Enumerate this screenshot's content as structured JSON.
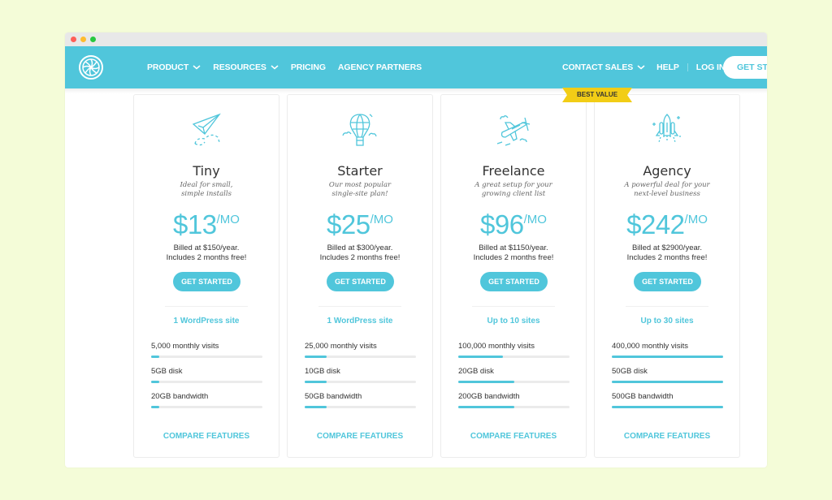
{
  "window": {
    "controls": [
      {
        "name": "close",
        "color": "#fe5f57"
      },
      {
        "name": "minimize",
        "color": "#febc2e"
      },
      {
        "name": "maximize",
        "color": "#28c840"
      }
    ]
  },
  "colors": {
    "brand": "#50c6db",
    "background": "#f4fcd8",
    "badge": "#f2cd16",
    "text": "#333333"
  },
  "navbar": {
    "logo_icon": "aperture-logo-icon",
    "left_items": [
      {
        "label": "PRODUCT",
        "has_dropdown": true
      },
      {
        "label": "RESOURCES",
        "has_dropdown": true
      },
      {
        "label": "PRICING",
        "has_dropdown": false
      },
      {
        "label": "AGENCY PARTNERS",
        "has_dropdown": false
      }
    ],
    "right_items": [
      {
        "label": "CONTACT SALES",
        "has_dropdown": true
      },
      {
        "label": "HELP",
        "has_dropdown": false
      },
      {
        "label": "LOG IN",
        "has_dropdown": false
      }
    ],
    "cta_label": "GET STARTED",
    "cta_visible_text": "GET STA"
  },
  "plans": [
    {
      "name": "Tiny",
      "icon": "paper-plane-icon",
      "desc_line1": "Ideal for small,",
      "desc_line2": "simple installs",
      "price": "$13",
      "per": "/MO",
      "billed": "Billed at $150/year.",
      "free": "Includes 2 months free!",
      "cta": "GET STARTED",
      "sites": "1 WordPress site",
      "features": [
        {
          "label": "5,000 monthly visits",
          "fill_percent": 7
        },
        {
          "label": "5GB disk",
          "fill_percent": 7
        },
        {
          "label": "20GB bandwidth",
          "fill_percent": 7
        }
      ],
      "compare": "COMPARE FEATURES",
      "badge": null
    },
    {
      "name": "Starter",
      "icon": "hot-air-balloon-icon",
      "desc_line1": "Our most popular",
      "desc_line2": "single-site plan!",
      "price": "$25",
      "per": "/MO",
      "billed": "Billed at $300/year.",
      "free": "Includes 2 months free!",
      "cta": "GET STARTED",
      "sites": "1 WordPress site",
      "features": [
        {
          "label": "25,000 monthly visits",
          "fill_percent": 20
        },
        {
          "label": "10GB disk",
          "fill_percent": 20
        },
        {
          "label": "50GB bandwidth",
          "fill_percent": 20
        }
      ],
      "compare": "COMPARE FEATURES",
      "badge": null
    },
    {
      "name": "Freelance",
      "icon": "airplane-icon",
      "desc_line1": "A great setup for your",
      "desc_line2": "growing client list",
      "price": "$96",
      "per": "/MO",
      "billed": "Billed at $1150/year.",
      "free": "Includes 2 months free!",
      "cta": "GET STARTED",
      "sites": "Up to 10 sites",
      "features": [
        {
          "label": "100,000 monthly visits",
          "fill_percent": 40
        },
        {
          "label": "20GB disk",
          "fill_percent": 50
        },
        {
          "label": "200GB bandwidth",
          "fill_percent": 50
        }
      ],
      "compare": "COMPARE FEATURES",
      "badge": null
    },
    {
      "name": "Agency",
      "icon": "space-shuttle-icon",
      "desc_line1": "A powerful deal for your",
      "desc_line2": "next-level business",
      "price": "$242",
      "per": "/MO",
      "billed": "Billed at $2900/year.",
      "free": "Includes 2 months free!",
      "cta": "GET STARTED",
      "sites": "Up to 30 sites",
      "features": [
        {
          "label": "400,000 monthly visits",
          "fill_percent": 100
        },
        {
          "label": "50GB disk",
          "fill_percent": 100
        },
        {
          "label": "500GB bandwidth",
          "fill_percent": 100
        }
      ],
      "compare": "COMPARE FEATURES",
      "badge": "BEST VALUE"
    }
  ]
}
